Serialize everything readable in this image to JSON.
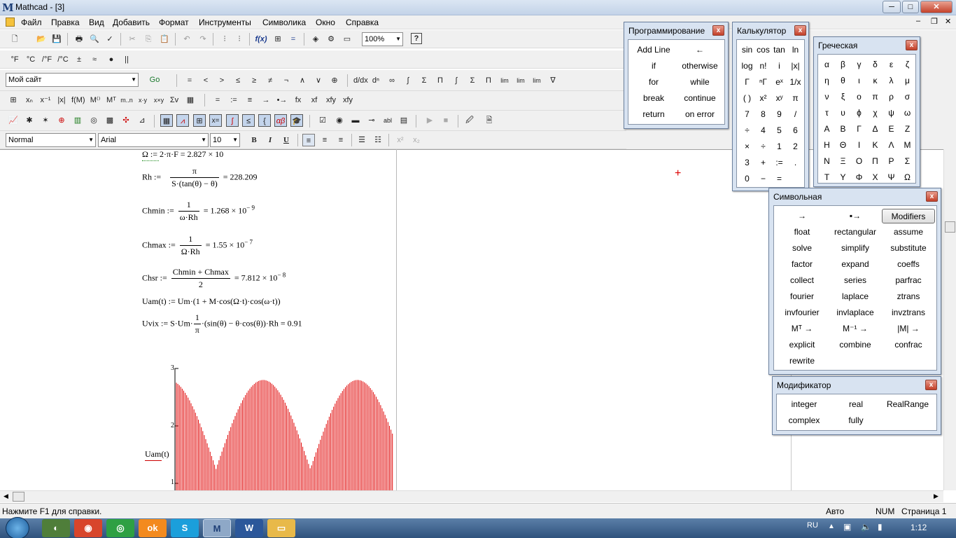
{
  "window": {
    "title": "Mathcad - [3]",
    "min": "─",
    "max": "□",
    "close": "✕",
    "mdi_min": "–",
    "mdi_restore": "❐",
    "mdi_close": "✕"
  },
  "menu": [
    "Файл",
    "Правка",
    "Вид",
    "Добавить",
    "Формат",
    "Инструменты",
    "Символика",
    "Окно",
    "Справка"
  ],
  "toolbar": {
    "zoom": "100%",
    "units": [
      "°F",
      "°C",
      "/°F",
      "/°C",
      "±",
      "≈",
      "●",
      "||"
    ],
    "site": "Мой сайт",
    "go": "Go",
    "math_ops": [
      "=",
      "<",
      ">",
      "≤",
      "≥",
      "≠",
      "¬",
      "∧",
      "∨",
      "⊕"
    ],
    "calc_ops": [
      "=",
      ":=",
      "≡",
      "→",
      "•→",
      "fx",
      "xf",
      "xfy",
      "xfy"
    ],
    "style": "Normal",
    "font": "Arial",
    "size": "10",
    "bold": "B",
    "italic": "I",
    "underline": "U"
  },
  "worksheet": {
    "line0": "Ω := 2·π·F = 2.827 × 10",
    "rh": {
      "lhs": "Rh :=",
      "num": "π",
      "den": "S·(tan(θ) − θ)",
      "result": "= 228.209"
    },
    "chmin": {
      "lhs": "Chmin :=",
      "num": "1",
      "den": "ω·Rh",
      "result": "= 1.268 × 10",
      "exp": "− 9"
    },
    "chmax": {
      "lhs": "Chmax :=",
      "num": "1",
      "den": "Ω·Rh",
      "result": "= 1.55 × 10",
      "exp": "− 7"
    },
    "chsr": {
      "lhs": "Chsr :=",
      "num": "Chmin + Chmax",
      "den": "2",
      "result": "= 7.812 × 10",
      "exp": "− 8"
    },
    "uam": "Uam(t) := Um·(1 + M·cos(Ω·t)·cos(ω·t))",
    "uvix": {
      "lhs": "Uvix := S·Um·",
      "num": "1",
      "den": "π",
      "rest": "·(sin(θ) − θ·cos(θ))·Rh = 0.91"
    },
    "plot_ylabel": "Uam(t)",
    "plot_ticks": [
      "3",
      "2",
      "1"
    ],
    "cursor": "+"
  },
  "chart_data": {
    "type": "line",
    "ylabel": "Uam(t)",
    "xlabel": "",
    "yticks": [
      1,
      2,
      3
    ],
    "color": "#e00000"
  },
  "panel_prog": {
    "title": "Программирование",
    "items": [
      [
        "Add Line",
        "←"
      ],
      [
        "if",
        "otherwise"
      ],
      [
        "for",
        "while"
      ],
      [
        "break",
        "continue"
      ],
      [
        "return",
        "on error"
      ]
    ]
  },
  "panel_calc": {
    "title": "Калькулятор",
    "rows": [
      [
        "sin",
        "cos",
        "tan",
        "ln"
      ],
      [
        "log",
        "n!",
        "i",
        "|x|"
      ],
      [
        "Γ",
        "ⁿΓ",
        "eˣ",
        "1/x"
      ],
      [
        "( )",
        "x²",
        "xʸ",
        "π"
      ],
      [
        "7",
        "8",
        "9",
        "/"
      ],
      [
        "÷",
        "4",
        "5",
        "6"
      ],
      [
        "×",
        "÷",
        "1",
        "2"
      ],
      [
        "3",
        "+",
        ":=",
        "."
      ],
      [
        "0",
        "−",
        "=",
        ""
      ]
    ]
  },
  "panel_greek": {
    "title": "Греческая",
    "rows": [
      [
        "α",
        "β",
        "γ",
        "δ",
        "ε",
        "ζ"
      ],
      [
        "η",
        "θ",
        "ι",
        "κ",
        "λ",
        "μ"
      ],
      [
        "ν",
        "ξ",
        "ο",
        "π",
        "ρ",
        "σ"
      ],
      [
        "τ",
        "υ",
        "ϕ",
        "χ",
        "ψ",
        "ω"
      ],
      [
        "Α",
        "Β",
        "Γ",
        "Δ",
        "Ε",
        "Ζ"
      ],
      [
        "Η",
        "Θ",
        "Ι",
        "Κ",
        "Λ",
        "Μ"
      ],
      [
        "Ν",
        "Ξ",
        "Ο",
        "Π",
        "Ρ",
        "Σ"
      ],
      [
        "Τ",
        "Υ",
        "Φ",
        "Χ",
        "Ψ",
        "Ω"
      ]
    ]
  },
  "panel_sym": {
    "title": "Символьная",
    "rows": [
      [
        "→",
        "▪→",
        "Modifiers"
      ],
      [
        "float",
        "rectangular",
        "assume"
      ],
      [
        "solve",
        "simplify",
        "substitute"
      ],
      [
        "factor",
        "expand",
        "coeffs"
      ],
      [
        "collect",
        "series",
        "parfrac"
      ],
      [
        "fourier",
        "laplace",
        "ztrans"
      ],
      [
        "invfourier",
        "invlaplace",
        "invztrans"
      ],
      [
        "Mᵀ →",
        "M⁻¹ →",
        "|M| →"
      ],
      [
        "explicit",
        "combine",
        "confrac"
      ],
      [
        "rewrite",
        "",
        ""
      ]
    ]
  },
  "panel_mod": {
    "title": "Модификатор",
    "rows": [
      [
        "integer",
        "real",
        "RealRange"
      ],
      [
        "complex",
        "fully",
        ""
      ]
    ]
  },
  "status": {
    "help": "Нажмите F1 для справки.",
    "mode": "Авто",
    "num": "NUM",
    "page": "Страница 1"
  },
  "taskbar": {
    "lang": "RU",
    "time": "1:12"
  }
}
